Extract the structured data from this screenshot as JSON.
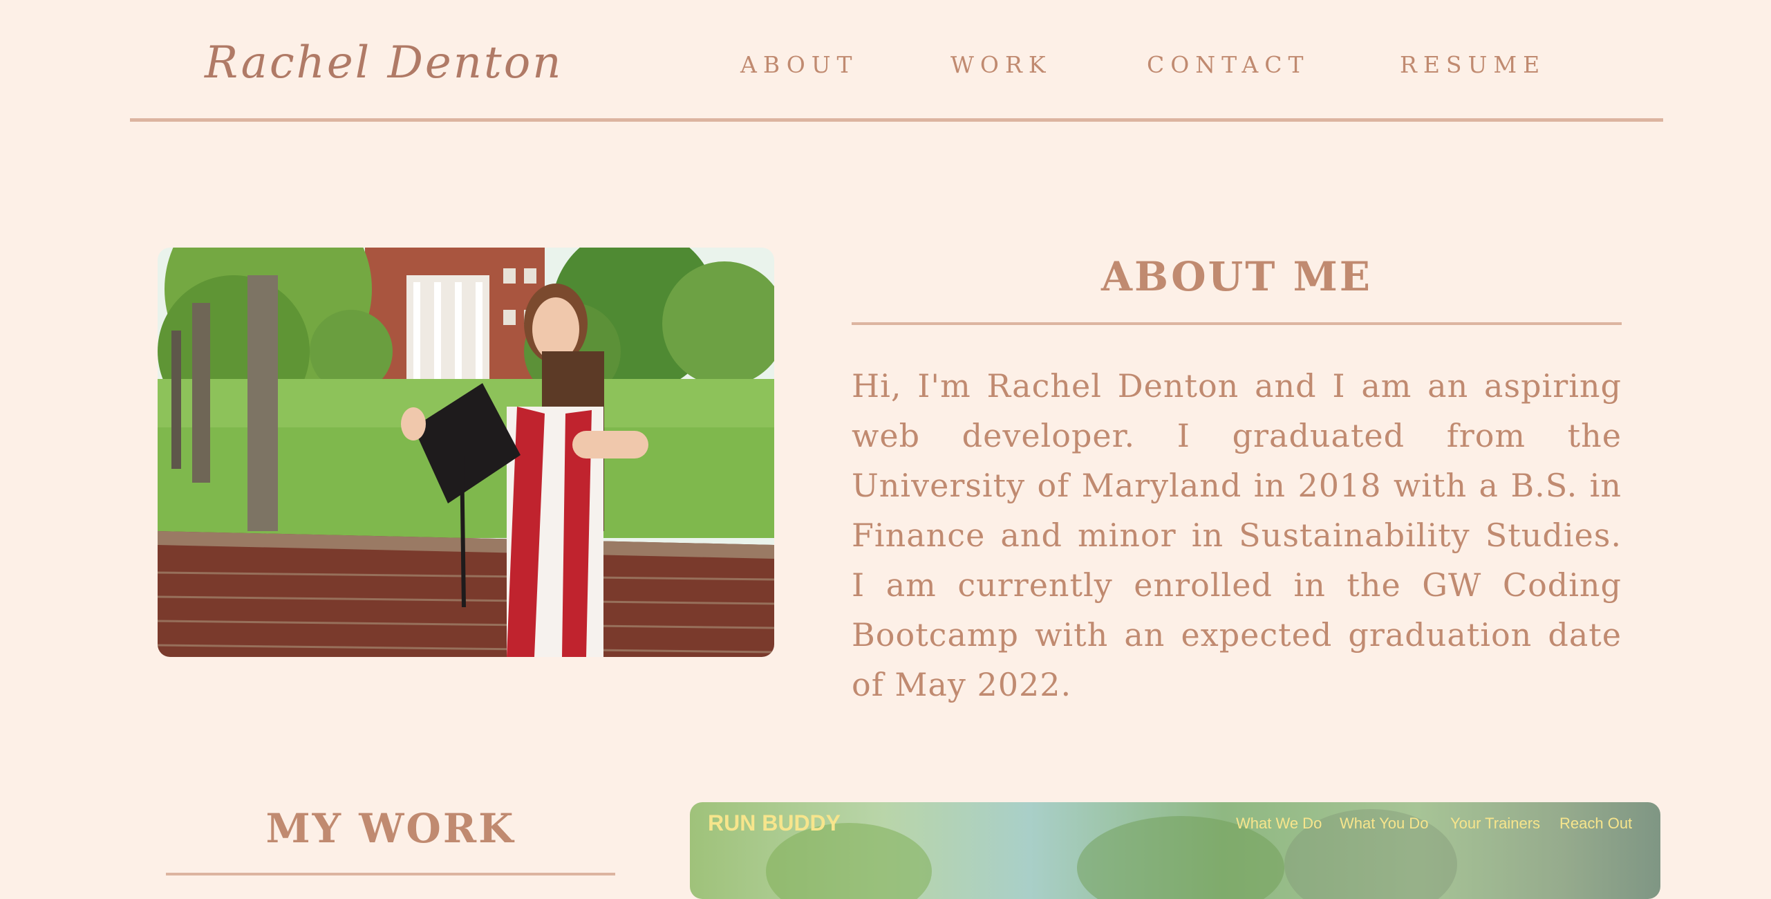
{
  "header": {
    "brand": "Rachel Denton",
    "nav": [
      "ABOUT",
      "WORK",
      "CONTACT",
      "RESUME"
    ]
  },
  "about": {
    "title": "ABOUT ME",
    "text": "Hi, I'm Rachel Denton and I am an aspiring web developer. I graduated from the University of Maryland in 2018 with a B.S. in Finance and minor in Sustainability Studies. I am currently enrolled in the GW Coding Bootcamp with an expected graduation date of May 2022."
  },
  "work": {
    "title": "MY WORK",
    "project": {
      "brand": "RUN BUDDY",
      "nav": [
        "What We Do",
        "What You Do",
        "Your Trainers",
        "Reach Out"
      ]
    }
  },
  "colors": {
    "background": "#fdf0e7",
    "accent": "#c08a70",
    "rule": "#dcb4a0"
  }
}
